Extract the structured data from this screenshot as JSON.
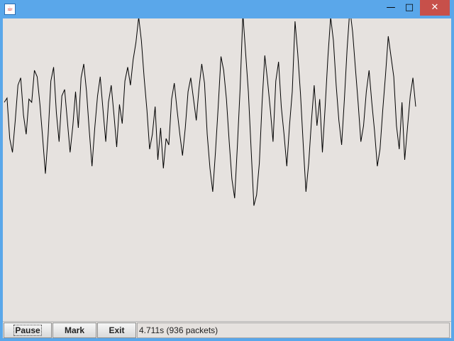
{
  "window": {
    "icon": "java-icon",
    "controls": {
      "minimize": "—",
      "maximize": "□",
      "close": "✕"
    }
  },
  "toolbar": {
    "pause_label": "Pause",
    "mark_label": "Mark",
    "exit_label": "Exit"
  },
  "status": {
    "text": "4.711s (936 packets)"
  },
  "colors": {
    "titlebar": "#5aa7ea",
    "close": "#c7504a",
    "client_background": "#e6e2df",
    "waveform": "#000000"
  },
  "waveform": {
    "description_type": "oscilloscope trace",
    "values": [
      0.12,
      0.16,
      -0.22,
      -0.35,
      -0.05,
      0.28,
      0.35,
      0.0,
      -0.18,
      0.15,
      0.12,
      0.42,
      0.36,
      0.1,
      -0.21,
      -0.55,
      -0.18,
      0.32,
      0.45,
      0.02,
      -0.25,
      0.18,
      0.24,
      -0.05,
      -0.35,
      -0.1,
      0.22,
      -0.12,
      0.35,
      0.48,
      0.22,
      -0.15,
      -0.48,
      -0.12,
      0.18,
      0.36,
      0.05,
      -0.25,
      0.12,
      0.28,
      0.0,
      -0.3,
      0.1,
      -0.08,
      0.32,
      0.45,
      0.28,
      0.52,
      0.68,
      0.92,
      0.7,
      0.35,
      0.05,
      -0.32,
      -0.18,
      0.08,
      -0.42,
      -0.12,
      -0.5,
      -0.22,
      -0.28,
      0.15,
      0.3,
      0.05,
      -0.18,
      -0.38,
      -0.12,
      0.22,
      0.35,
      0.15,
      -0.05,
      0.25,
      0.48,
      0.3,
      -0.18,
      -0.5,
      -0.72,
      -0.35,
      0.08,
      0.55,
      0.42,
      0.15,
      -0.25,
      -0.6,
      -0.78,
      -0.28,
      0.25,
      0.95,
      0.58,
      0.22,
      -0.32,
      -0.85,
      -0.75,
      -0.45,
      0.12,
      0.56,
      0.32,
      0.05,
      -0.25,
      0.32,
      0.5,
      0.08,
      -0.18,
      -0.48,
      -0.1,
      0.22,
      0.88,
      0.58,
      0.2,
      -0.28,
      -0.72,
      -0.45,
      -0.05,
      0.28,
      -0.1,
      0.15,
      -0.35,
      0.08,
      0.55,
      0.92,
      0.7,
      0.28,
      -0.05,
      -0.28,
      0.15,
      0.62,
      1.0,
      0.78,
      0.45,
      0.12,
      -0.25,
      -0.1,
      0.22,
      0.42,
      0.12,
      -0.15,
      -0.48,
      -0.32,
      0.05,
      0.38,
      0.74,
      0.55,
      0.36,
      -0.1,
      -0.32,
      0.12,
      -0.42,
      -0.12,
      0.18,
      0.35,
      0.08
    ]
  }
}
